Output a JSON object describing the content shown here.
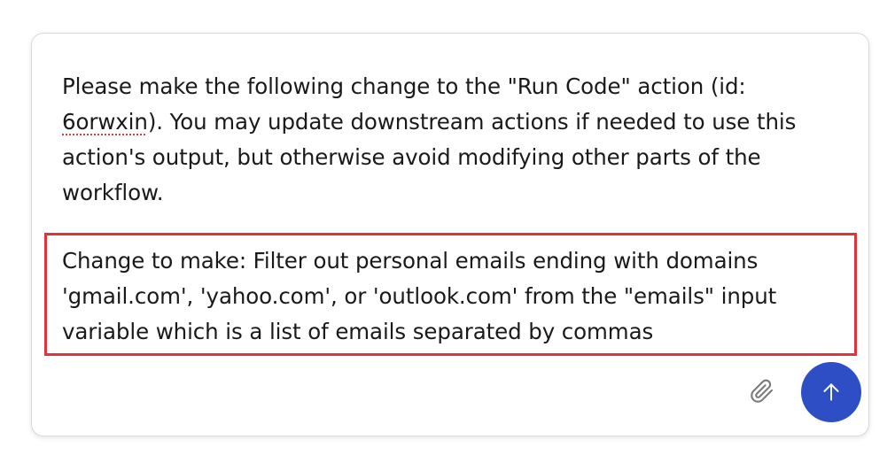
{
  "composer": {
    "message_line_1": "Please make the following change to the \"Run Code\" action (id: ",
    "action_id": "6orwxin",
    "message_line_2": "). You may update downstream actions if needed to use this action's output, but otherwise avoid modifying other parts of the workflow.",
    "change_text": "Change to make: Filter out personal emails ending with domains 'gmail.com', 'yahoo.com', or 'outlook.com' from the \"emails\" input variable which is a list of emails separated by commas",
    "attach_icon": "paperclip-icon",
    "send_icon": "arrow-up-icon"
  },
  "colors": {
    "send_button_bg": "#2d4ec4",
    "highlight_border": "#e0333c",
    "spellcheck_underline": "#e03a3a",
    "icon_gray": "#7a7a7a"
  }
}
